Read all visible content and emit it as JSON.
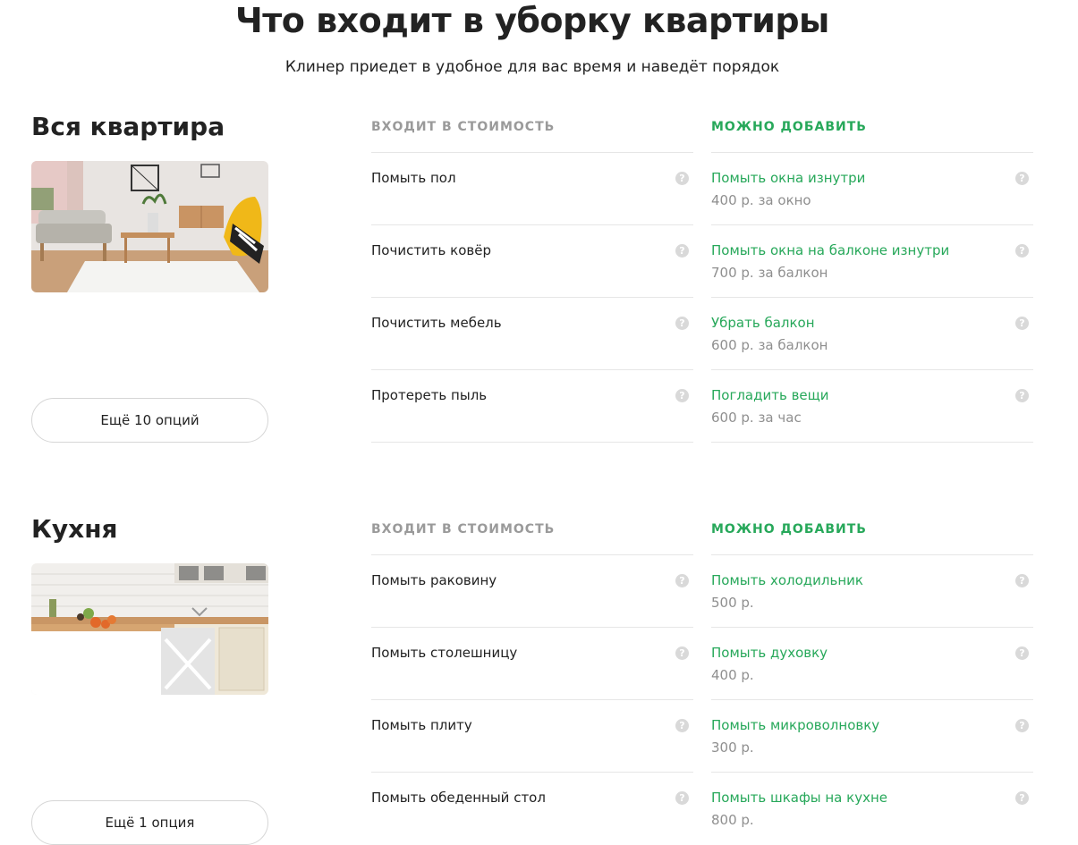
{
  "header": {
    "title": "Что входит в уборку квартиры",
    "subtitle": "Клинер приедет в удобное для вас время и наведёт порядок"
  },
  "sections": [
    {
      "title": "Вся квартира",
      "more_button": "Ещё 10 опций",
      "included_heading": "ВХОДИТ В СТОИМОСТЬ",
      "addable_heading": "МОЖНО ДОБАВИТЬ",
      "included": [
        {
          "name": "Помыть пол"
        },
        {
          "name": "Почистить ковёр"
        },
        {
          "name": "Почистить мебель"
        },
        {
          "name": "Протереть пыль"
        }
      ],
      "addable": [
        {
          "name": "Помыть окна изнутри",
          "price": "400 р. за окно"
        },
        {
          "name": "Помыть окна на балконе изнутри",
          "price": "700 р. за балкон"
        },
        {
          "name": "Убрать балкон",
          "price": "600 р. за балкон"
        },
        {
          "name": "Погладить вещи",
          "price": "600 р. за час"
        }
      ]
    },
    {
      "title": "Кухня",
      "more_button": "Ещё 1 опция",
      "included_heading": "ВХОДИТ В СТОИМОСТЬ",
      "addable_heading": "МОЖНО ДОБАВИТЬ",
      "included": [
        {
          "name": "Помыть раковину"
        },
        {
          "name": "Помыть столешницу"
        },
        {
          "name": "Помыть плиту"
        },
        {
          "name": "Помыть обеденный стол"
        }
      ],
      "addable": [
        {
          "name": "Помыть холодильник",
          "price": "500 р."
        },
        {
          "name": "Помыть духовку",
          "price": "400 р."
        },
        {
          "name": "Помыть микроволновку",
          "price": "300 р."
        },
        {
          "name": "Помыть шкафы на кухне",
          "price": "800 р."
        }
      ]
    }
  ],
  "icons": {
    "help_icon_glyph": "?"
  },
  "colors": {
    "accent_green": "#27a85a",
    "muted_gray": "#9a9a9a",
    "help_icon_bg": "#d9d9d9"
  }
}
